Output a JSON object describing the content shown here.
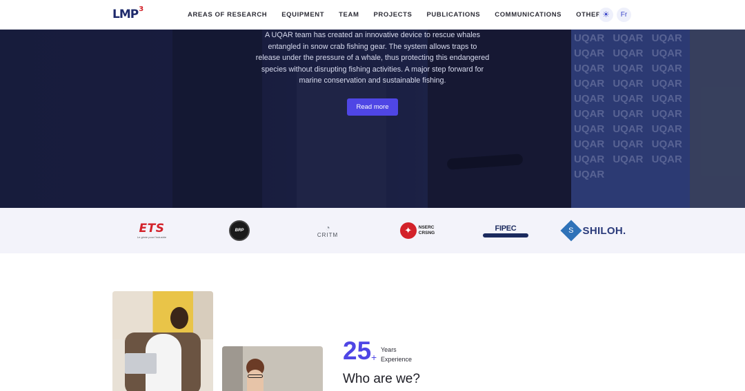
{
  "header": {
    "logo": {
      "text": "LMP",
      "sup": "3"
    },
    "nav": [
      {
        "label": "AREAS OF RESEARCH"
      },
      {
        "label": "EQUIPMENT"
      },
      {
        "label": "TEAM"
      },
      {
        "label": "PROJECTS"
      },
      {
        "label": "PUBLICATIONS"
      },
      {
        "label": "COMMUNICATIONS"
      },
      {
        "label": "OTHERS",
        "has_dropdown": true
      }
    ],
    "theme_toggle_icon": "sun-icon",
    "theme_toggle_glyph": "☀",
    "language_button": "Fr"
  },
  "hero": {
    "lines": [
      "A UQAR team has created an innovative device to rescue whales",
      "entangled in snow crab fishing gear. The system allows traps to",
      "release under the pressure of a whale, thus protecting this endangered",
      "species without disrupting fishing activities. A major step forward for",
      "marine conservation and sustainable fishing."
    ],
    "button": "Read more",
    "banner_text": "UQAR UQAR UQAR UQAR UQAR UQAR UQAR UQAR UQAR UQAR UQAR UQAR UQAR UQAR UQAR UQAR UQAR UQAR UQAR UQAR UQAR UQAR UQAR UQAR UQAR UQAR UQAR UQAR"
  },
  "partners": {
    "ets": {
      "name": "ETS",
      "tagline": "Le génie pour l'industrie"
    },
    "brp": {
      "name": "BRP"
    },
    "critm": {
      "mark": "◔",
      "name": "CRITM"
    },
    "nserc": {
      "leaf": "✦",
      "line1": "NSERC",
      "line2": "CRSNG"
    },
    "fipec": {
      "name": "FIPEC"
    },
    "shiloh": {
      "mark": "S",
      "name": "SHILOH."
    }
  },
  "about": {
    "stat_number": "25",
    "stat_plus": "+",
    "stat_label_1": "Years",
    "stat_label_2": "Experience",
    "title": "Who are we?"
  },
  "colors": {
    "accent": "#4f46e5",
    "logo_navy": "#1e2a6b",
    "logo_red": "#d3222a",
    "hero_bg": "#1c2142",
    "partners_bg": "#f3f3fa"
  }
}
